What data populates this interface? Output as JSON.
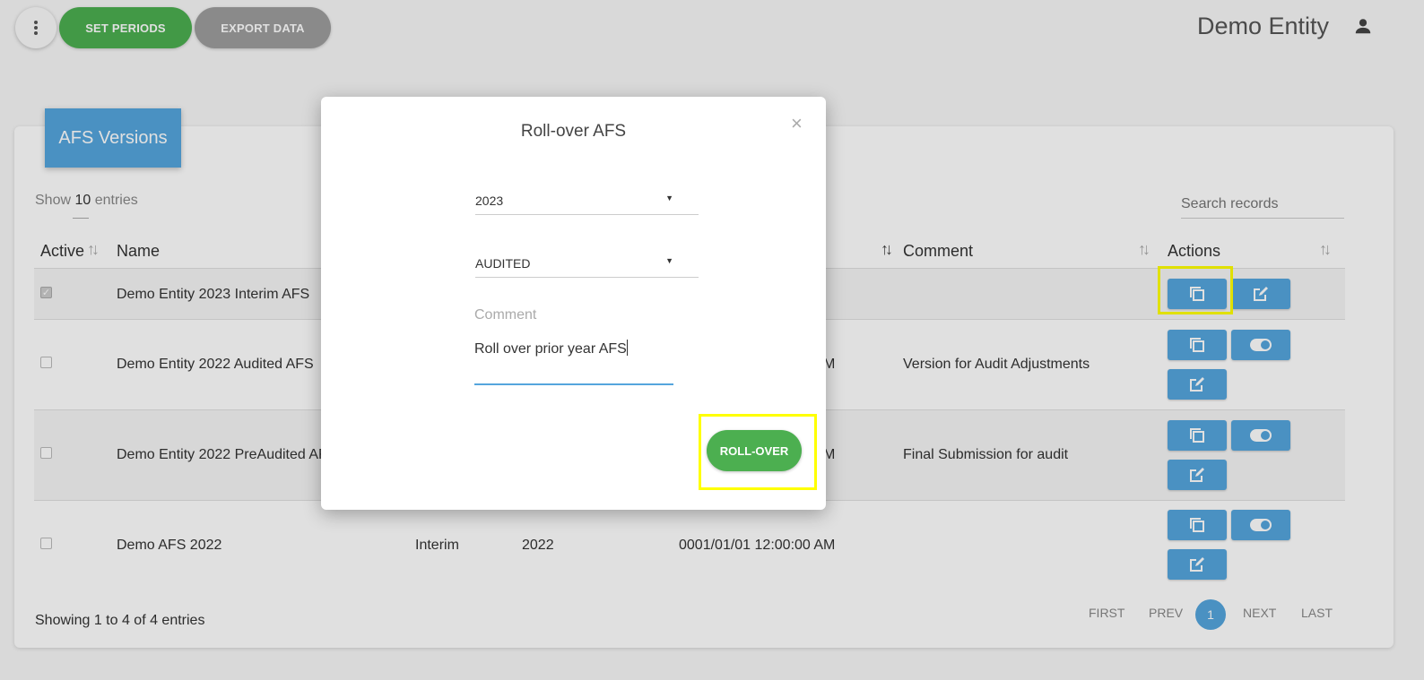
{
  "topbar": {
    "menu_icon": "vertical-dots-icon",
    "set_periods": "SET PERIODS",
    "export_data": "EXPORT DATA",
    "entity_name": "Demo Entity",
    "user_icon": "person-icon"
  },
  "card": {
    "header": "AFS Versions",
    "show_prefix": "Show",
    "show_count": "10",
    "show_suffix": "entries",
    "search_placeholder": "Search records",
    "columns": {
      "active": "Active",
      "name": "Name",
      "comment": "Comment",
      "actions": "Actions"
    },
    "rows": [
      {
        "active": true,
        "name": "Demo Entity 2023 Interim AFS",
        "type": "",
        "year": "",
        "date": "",
        "comment": ""
      },
      {
        "active": false,
        "name": "Demo Entity 2022 Audited AFS",
        "type": "",
        "year": "",
        "date": "M",
        "comment": "Version for Audit Adjustments"
      },
      {
        "active": false,
        "name": "Demo Entity 2022 PreAudited AFS",
        "type": "",
        "year": "",
        "date": "M",
        "comment": "Final Submission for audit"
      },
      {
        "active": false,
        "name": "Demo AFS 2022",
        "type": "Interim",
        "year": "2022",
        "date": "0001/01/01 12:00:00 AM",
        "comment": ""
      }
    ],
    "footer": "Showing 1 to 4 of 4 entries",
    "pagination": {
      "first": "FIRST",
      "prev": "PREV",
      "current": "1",
      "next": "NEXT",
      "last": "LAST"
    }
  },
  "modal": {
    "title": "Roll-over AFS",
    "close": "×",
    "year_select": "2023",
    "type_select": "AUDITED",
    "comment_label": "Comment",
    "comment_value": "Roll over prior year AFS",
    "button": "ROLL-OVER"
  },
  "colors": {
    "accent_blue": "#55a5dd",
    "green": "#4caf50",
    "grey": "#9e9e9e",
    "highlight": "#ffff00"
  }
}
